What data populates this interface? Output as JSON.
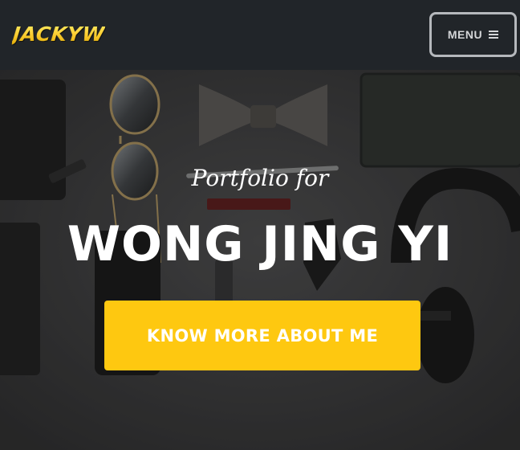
{
  "navbar": {
    "brand": "JACKYW",
    "menu_label": "MENU",
    "menu_icon": "hamburger-icon"
  },
  "hero": {
    "subheading": "Portfolio for",
    "heading": "WONG JING YI",
    "cta_label": "KNOW MORE ABOUT ME",
    "background": "flat-lay-accessories-photo"
  },
  "colors": {
    "navbar_bg": "#212529",
    "brand": "#fed136",
    "cta_bg": "#fec810",
    "hero_text": "#ffffff"
  }
}
